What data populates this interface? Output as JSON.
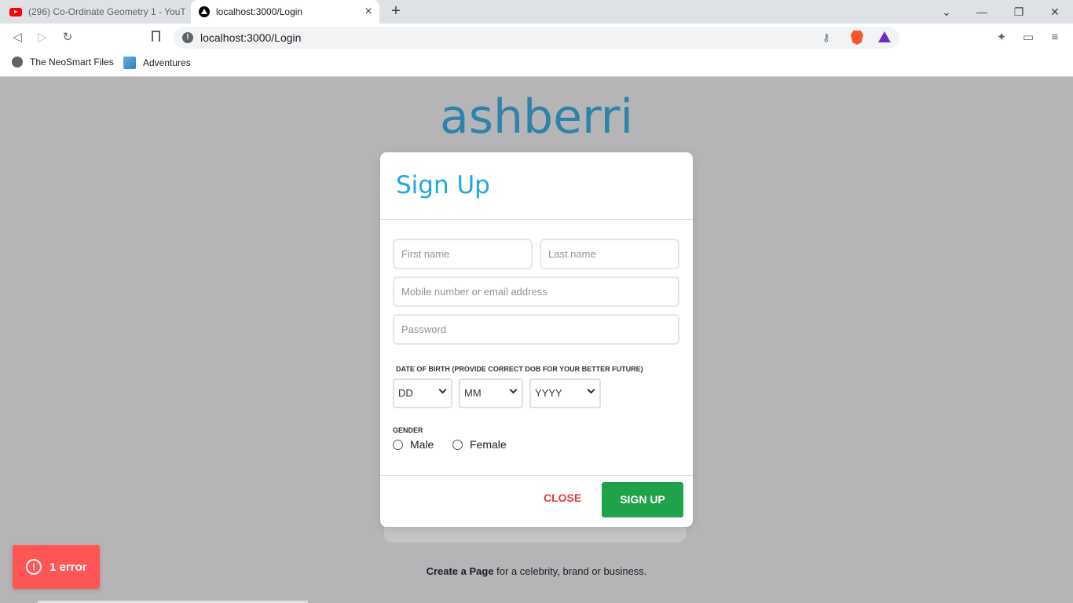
{
  "browser": {
    "tabs": [
      {
        "title": "(296) Co-Ordinate Geometry 1 - YouTube",
        "icon": "youtube-icon",
        "active": false
      },
      {
        "title": "localhost:3000/Login",
        "icon": "nextjs-icon",
        "active": true
      }
    ],
    "url": "localhost:3000/Login",
    "bookmarks": [
      {
        "label": "The NeoSmart Files",
        "icon": "globe-icon"
      },
      {
        "label": "Adventures",
        "icon": "image-icon"
      }
    ]
  },
  "page": {
    "brand": "ashberri",
    "footer_bold": "Create a Page",
    "footer_rest": " for a celebrity, brand or business."
  },
  "modal": {
    "title": "Sign Up",
    "first_name_placeholder": "First name",
    "last_name_placeholder": "Last name",
    "contact_placeholder": "Mobile number or email address",
    "password_placeholder": "Password",
    "dob_label": "DATE OF BIRTH (PROVIDE CORRECT DOB FOR YOUR BETTER FUTURE)",
    "dob_day": "DD",
    "dob_month": "MM",
    "dob_year": "YYYY",
    "gender_label": "GENDER",
    "gender_male": "Male",
    "gender_female": "Female",
    "close_label": "CLOSE",
    "signup_label": "SIGN UP"
  },
  "error_toast": {
    "label": "1 error"
  },
  "colors": {
    "brand": "#2e84a8",
    "title": "#1ea7e0",
    "signup_bg": "#1ea34a",
    "close_text": "#e23a3a",
    "error_bg": "#ff5555"
  }
}
